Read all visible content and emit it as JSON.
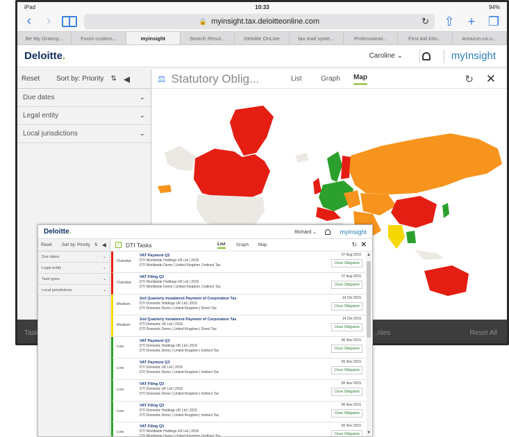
{
  "tablet": {
    "status_left": "iPad",
    "status_time": "10:33",
    "status_right": "94%",
    "url": "myinsight.tax.deloitteonline.com",
    "browser_tabs": [
      "Be My Granny...",
      "Foom custom...",
      "myinsight",
      "Search Resul...",
      "Deloitte OnLine",
      "tax mail syste...",
      "Professional...",
      "First Aid Kits...",
      "Amazon.co.u..."
    ],
    "active_tab_index": 2,
    "app": {
      "logo": "Deloitte",
      "user": "Caroline",
      "brand": "myInsight"
    },
    "sidebar": {
      "reset": "Reset",
      "sort": "Sort by: Priority",
      "filters": [
        "Due dates",
        "Legal entity",
        "Local jurisdictions"
      ]
    },
    "main": {
      "title": "Statutory Oblig...",
      "tabs": [
        "List",
        "Graph",
        "Map"
      ],
      "active_tab": "Map"
    },
    "footer": {
      "left": "Tasks",
      "mid": "...rites",
      "right": "Reset All"
    }
  },
  "front": {
    "logo": "Deloitte",
    "user": "Richard",
    "brand": "myInsight",
    "sidebar": {
      "reset": "Reset",
      "sort": "Sort by: Priority",
      "filters": [
        "Due dates",
        "Legal entity",
        "Task types",
        "Local jurisdictions"
      ]
    },
    "main": {
      "title": "DTI Tasks",
      "tabs": [
        "List",
        "Graph",
        "Map"
      ],
      "active_tab": "List"
    },
    "tasks": [
      {
        "priority": "Overdue",
        "color": "#e41e13",
        "name": "VAT Payment Q2",
        "entity": "DTI Worldwide Holdings UK Ltd | 2015",
        "details": "DTI Worldwide Demo | United Kingdom | Indirect Tax",
        "date": "07 Aug 2015",
        "action": "Close Obligation"
      },
      {
        "priority": "Overdue",
        "color": "#e41e13",
        "name": "VAT Filing Q2",
        "entity": "DTI Worldwide Holdings UK Ltd | 2015",
        "details": "DTI Worldwide Demo | United Kingdom | Indirect Tax",
        "date": "07 Aug 2015",
        "action": "Close Obligation"
      },
      {
        "priority": "Medium",
        "color": "#f5d800",
        "name": "2nd Quarterly Instalment Payment of Corporation Tax",
        "entity": "DTI Domestic Holdings UK Ltd | 2015",
        "details": "DTI Domestic Demo | United Kingdom | Direct Tax",
        "date": "14 Oct 2015",
        "action": "Close Obligation"
      },
      {
        "priority": "Medium",
        "color": "#f5d800",
        "name": "2nd Quarterly Instalment Payment of Corporation Tax",
        "entity": "DTI Domestic UK Ltd | 2015",
        "details": "DTI Domestic Demo | United Kingdom | Direct Tax",
        "date": "14 Oct 2015",
        "action": "Close Obligation"
      },
      {
        "priority": "Low",
        "color": "#2ca02c",
        "name": "VAT Payment Q3",
        "entity": "DTI Domestic Holdings UK Ltd | 2015",
        "details": "DTI Domestic Demo | United Kingdom | Indirect Tax",
        "date": "06 Nov 2015",
        "action": "Close Obligation"
      },
      {
        "priority": "Low",
        "color": "#2ca02c",
        "name": "VAT Payment Q3",
        "entity": "DTI Domestic UK Ltd | 2015",
        "details": "DTI Domestic Demo | United Kingdom | Indirect Tax",
        "date": "06 Nov 2015",
        "action": "Close Obligation"
      },
      {
        "priority": "Low",
        "color": "#2ca02c",
        "name": "VAT Filing Q3",
        "entity": "DTI Domestic UK Ltd | 2015",
        "details": "DTI Domestic Demo | United Kingdom | Indirect Tax",
        "date": "06 Nov 2015",
        "action": "Close Obligation"
      },
      {
        "priority": "Low",
        "color": "#2ca02c",
        "name": "VAT Filing Q3",
        "entity": "DTI Domestic Holdings UK Ltd | 2015",
        "details": "DTI Domestic Demo | United Kingdom | Indirect Tax",
        "date": "06 Nov 2015",
        "action": "Close Obligation"
      },
      {
        "priority": "Low",
        "color": "#2ca02c",
        "name": "VAT Filing Q3",
        "entity": "DTI Worldwide Holdings UK Ltd | 2015",
        "details": "DTI Worldwide Demo | United Kingdom | Indirect Tax",
        "date": "06 Nov 2015",
        "action": "Close Obligation"
      }
    ]
  },
  "colors": {
    "deloitte_navy": "#0f2c5c",
    "deloitte_green": "#86bc25",
    "overdue": "#e41e13",
    "medium": "#f5d800",
    "low": "#2ca02c",
    "map_orange": "#f7941d",
    "map_red": "#e41e13",
    "map_yellow": "#f5d800",
    "map_green": "#2ca02c",
    "map_land": "#ece9e4"
  }
}
